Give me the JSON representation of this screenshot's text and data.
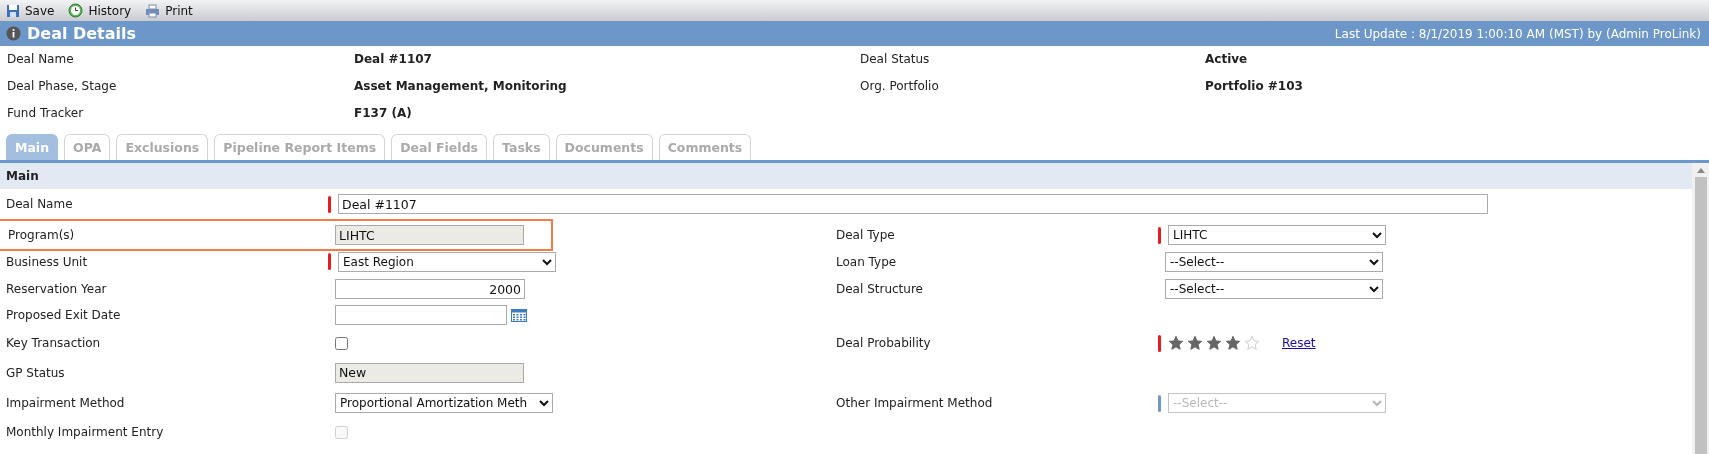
{
  "toolbar": [
    {
      "kind": "save",
      "label": "Save"
    },
    {
      "kind": "history",
      "label": "History"
    },
    {
      "kind": "print",
      "label": "Print"
    }
  ],
  "header": {
    "title": "Deal Details",
    "last_update": "Last Update : 8/1/2019 1:00:10 AM (MST) by (Admin ProLink)"
  },
  "summary": [
    {
      "label": "Deal Name",
      "value": "Deal #1107"
    },
    {
      "label": "Deal Status",
      "value": "Active"
    },
    {
      "label": "Deal Phase, Stage",
      "value": "Asset Management, Monitoring"
    },
    {
      "label": "Org. Portfolio",
      "value": "Portfolio #103"
    },
    {
      "label": "Fund Tracker",
      "value": "F137 (A)"
    }
  ],
  "tabs": [
    {
      "label": "Main",
      "selected": true
    },
    {
      "label": "OPA",
      "selected": false
    },
    {
      "label": "Exclusions",
      "selected": false
    },
    {
      "label": "Pipeline Report Items",
      "selected": false
    },
    {
      "label": "Deal Fields",
      "selected": false
    },
    {
      "label": "Tasks",
      "selected": false
    },
    {
      "label": "Documents",
      "selected": false
    },
    {
      "label": "Comments",
      "selected": false
    }
  ],
  "section": {
    "title": "Main"
  },
  "rows": [
    {
      "highlighted": false,
      "left": {
        "label": "Deal Name",
        "kind": "long_text",
        "required": true,
        "value": "Deal #1107"
      }
    },
    {
      "highlighted": true,
      "left": {
        "label": "Program(s)",
        "kind": "readonly",
        "required": false,
        "value": "LIHTC"
      },
      "right": {
        "label": "Deal Type",
        "kind": "select",
        "required": true,
        "value": "LIHTC",
        "disabled": false
      }
    },
    {
      "highlighted": false,
      "left": {
        "label": "Business Unit",
        "kind": "select",
        "required": true,
        "value": "East Region",
        "disabled": false
      },
      "right": {
        "label": "Loan Type",
        "kind": "select",
        "required": false,
        "value": "--Select--",
        "disabled": false
      }
    },
    {
      "highlighted": false,
      "left": {
        "label": "Reservation Year",
        "kind": "number",
        "required": false,
        "value": "2000"
      },
      "right": {
        "label": "Deal Structure",
        "kind": "select",
        "required": false,
        "value": "--Select--",
        "disabled": false
      }
    },
    {
      "highlighted": false,
      "left": {
        "label": "Proposed Exit Date",
        "kind": "date",
        "required": false
      }
    },
    {
      "highlighted": false,
      "left": {
        "label": "Key Transaction",
        "kind": "checkbox",
        "required": false,
        "checked": false,
        "disabled": false
      },
      "right": {
        "label": "Deal Probability",
        "kind": "stars",
        "required": true,
        "stars": 4,
        "link": "Reset"
      }
    },
    {
      "highlighted": false,
      "left": {
        "label": "GP Status",
        "kind": "readonly",
        "required": false,
        "value": "New"
      }
    },
    {
      "highlighted": false,
      "left": {
        "label": "Impairment Method",
        "kind": "select",
        "required": false,
        "value": "Proportional Amortization Meth",
        "disabled": false
      },
      "right": {
        "label": "Other Impairment Method",
        "kind": "select",
        "required": false,
        "noted": true,
        "value": "--Select--",
        "disabled": true
      }
    },
    {
      "highlighted": false,
      "left": {
        "label": "Monthly Impairment Entry",
        "kind": "checkbox",
        "required": false,
        "checked": false,
        "disabled": true
      }
    }
  ]
}
